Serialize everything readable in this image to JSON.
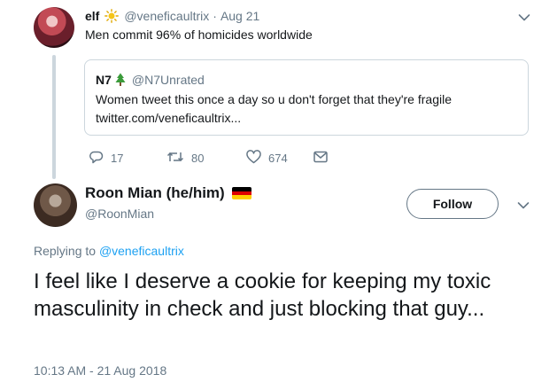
{
  "parent_tweet": {
    "name": "elf",
    "handle": "@veneficaultrix",
    "separator": "·",
    "date": "Aug 21",
    "text": "Men commit 96% of homicides worldwide",
    "quote": {
      "name": "N7",
      "handle": "@N7Unrated",
      "text": "Women tweet this once a day so u don't forget that they're fragile",
      "link": "twitter.com/veneficaultrix..."
    },
    "actions": {
      "replies": "17",
      "retweets": "80",
      "likes": "674"
    }
  },
  "main_tweet": {
    "name": "Roon Mian (he/him)",
    "handle": "@RoonMian",
    "follow_label": "Follow",
    "replying_prefix": "Replying to ",
    "replying_handle": "@veneficaultrix",
    "text": "I feel like I deserve a cookie for keeping my toxic masculinity in check and just blocking that guy...",
    "timestamp": "10:13 AM - 21 Aug 2018"
  },
  "colors": {
    "link_blue": "#1da1f2",
    "secondary_text": "#657786",
    "border": "#ccd6dd",
    "flag": [
      "#000000",
      "#dd0000",
      "#ffce00"
    ]
  },
  "icons": [
    "sun-emoji-icon",
    "tree-emoji-icon",
    "reply-icon",
    "retweet-icon",
    "like-icon",
    "message-icon",
    "chevron-down-icon",
    "germany-flag-icon"
  ]
}
